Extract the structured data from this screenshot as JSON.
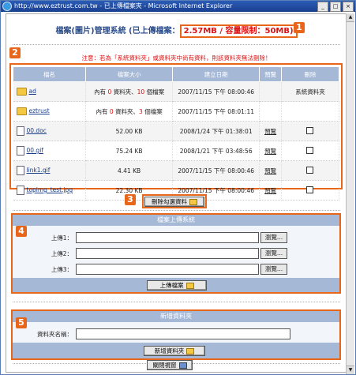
{
  "window": {
    "title": "http://www.eztrust.com.tw - 已上傳檔案夾 - Microsoft Internet Explorer",
    "min": "_",
    "max": "□",
    "close": "×"
  },
  "header": {
    "title_prefix": "檔案(圖片)管理系統 (已上傳檔案：",
    "usage": "2.57MB / 容量限制：50MB)"
  },
  "badges": [
    "1",
    "2",
    "3",
    "4",
    "5"
  ],
  "note": "注意：若為「系統資料夾」或資料夾中尚有資料，則該資料夾無法刪除！",
  "table": {
    "headers": [
      "檔名",
      "檔案大小",
      "建立日期",
      "預覽",
      "刪除"
    ],
    "rows": [
      {
        "name": "ad",
        "type": "folder",
        "size_a": "內有 ",
        "size_n1": "0",
        "size_b": " 資料夾、",
        "size_n2": "10",
        "size_c": " 個檔案",
        "date": "2007/11/15 下午 08:00:46",
        "preview": "",
        "delete": "系統資料夾"
      },
      {
        "name": "eztrust",
        "type": "folder",
        "size_a": "內有 ",
        "size_n1": "0",
        "size_b": " 資料夾、",
        "size_n2": "3",
        "size_c": " 個檔案",
        "date": "2007/11/15 下午 08:01:11",
        "preview": "",
        "delete": ""
      },
      {
        "name": "00.doc",
        "type": "file",
        "size": "52.00 KB",
        "date": "2008/1/24 下午 01:38:01",
        "preview": "預覽",
        "delete": "checkbox"
      },
      {
        "name": "00.gif",
        "type": "file",
        "size": "75.24 KB",
        "date": "2008/1/21 下午 03:48:56",
        "preview": "預覽",
        "delete": "checkbox"
      },
      {
        "name": "link1.gif",
        "type": "file",
        "size": "4.41 KB",
        "date": "2007/11/15 下午 08:00:46",
        "preview": "預覽",
        "delete": "checkbox"
      },
      {
        "name": "topimg_test.jpg",
        "type": "file",
        "size": "22.30 KB",
        "date": "2007/11/15 下午 08:00:46",
        "preview": "預覽",
        "delete": "checkbox"
      }
    ]
  },
  "delete_button": "刪除勾選資料",
  "upload": {
    "title": "檔案上傳系統",
    "labels": [
      "上傳1：",
      "上傳2：",
      "上傳3："
    ],
    "browse": "瀏覽...",
    "submit": "上傳檔案"
  },
  "new_folder": {
    "title": "新增資料夾",
    "label": "資料夾名稱：",
    "submit": "新增資料夾"
  },
  "close_button": "關閉視窗",
  "colors": {
    "accent": "#e8661a",
    "highlight": "#dd1111",
    "header_bar": "#a5b8d6",
    "title_text": "#2c4d8a"
  }
}
